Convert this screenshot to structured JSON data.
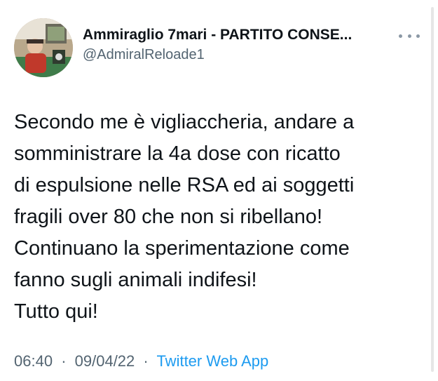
{
  "tweet": {
    "author": {
      "display_name": "Ammiraglio 7mari - PARTITO CONSE...",
      "handle": "@AdmiralReloade1",
      "avatar_icon": "avatar-photo"
    },
    "more_icon": "more-horizontal-icon",
    "text": "Secondo me è vigliaccheria, andare a\nsomministrare la 4a dose con ricatto\ndi espulsione nelle RSA ed ai soggetti\nfragili over 80 che non si ribellano!\nContinuano la sperimentazione come\nfanno sugli animali indifesi!\nTutto qui!",
    "time": "06:40",
    "date": "09/04/22",
    "separator": "·",
    "source": "Twitter Web App"
  },
  "colors": {
    "text": "#0f1419",
    "secondary": "#536471",
    "link": "#1d9bf0"
  }
}
